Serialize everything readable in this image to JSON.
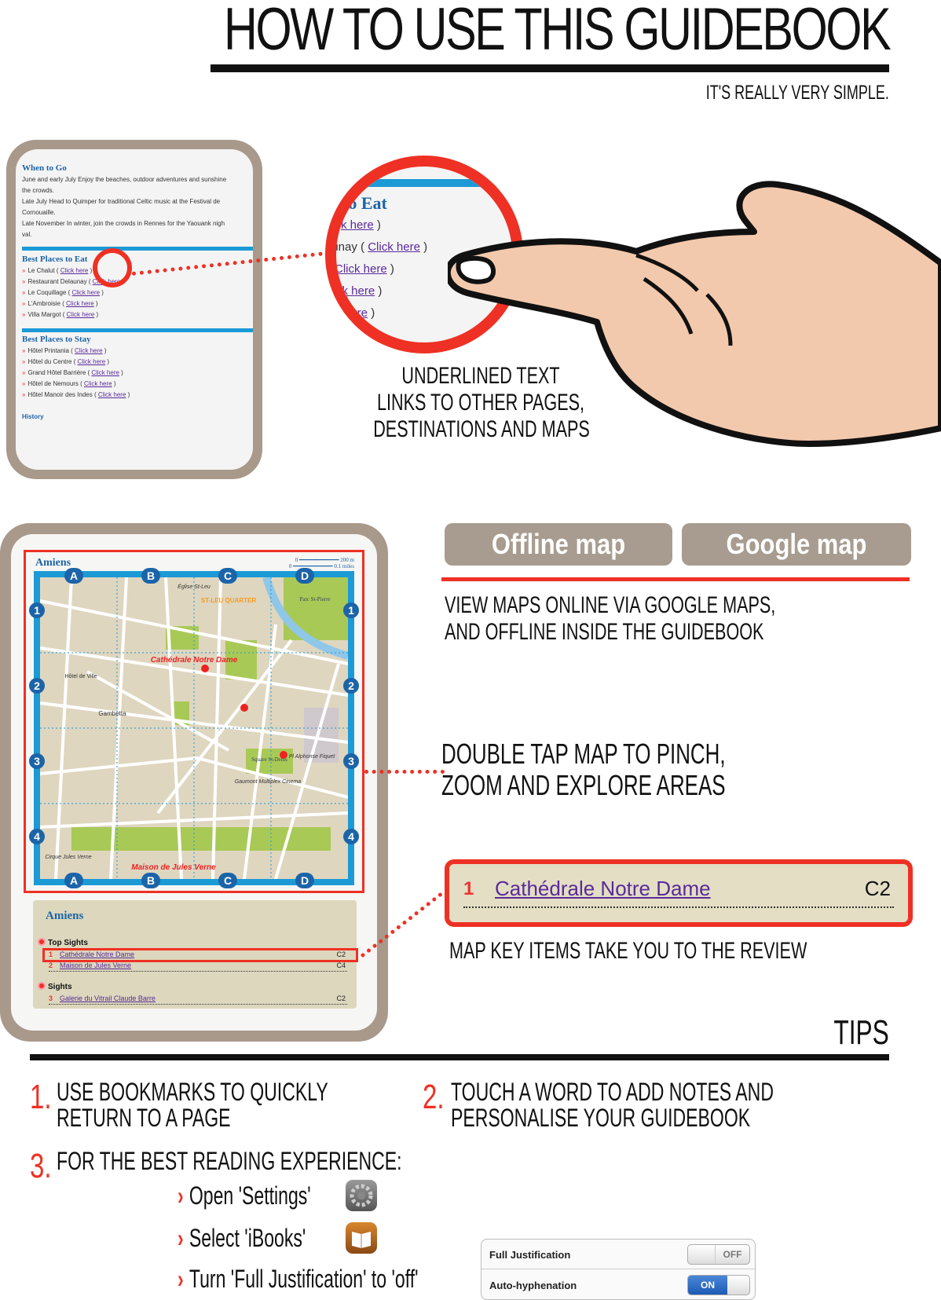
{
  "header": {
    "title": "HOW TO USE THIS GUIDEBOOK",
    "subtitle": "IT'S REALLY VERY SIMPLE."
  },
  "section_links": {
    "page": {
      "when_heading": "When to Go",
      "when_lines": [
        "June and early July Enjoy the beaches, outdoor adventures and sunshine",
        "the crowds.",
        "Late July Head to Quimper for traditional Celtic music at the Festival de",
        "Cornouaille.",
        "Late November In winter, join the crowds in Rennes for the Yaouank nigh",
        "val."
      ],
      "eat_heading": "Best Places to Eat",
      "eat_items": [
        {
          "name": "Le Chalut",
          "link": "Click here"
        },
        {
          "name": "Restaurant Delaunay",
          "link": "Click here"
        },
        {
          "name": "Le Coquillage",
          "link": "Click here"
        },
        {
          "name": "L'Ambroisie",
          "link": "Click here"
        },
        {
          "name": "Villa Margot",
          "link": "Click here"
        }
      ],
      "stay_heading": "Best Places to Stay",
      "stay_items": [
        {
          "name": "Hôtel Printania",
          "link": "Click here"
        },
        {
          "name": "Hôtel du Centre",
          "link": "Click here"
        },
        {
          "name": "Grand Hôtel Barrière",
          "link": "Click here"
        },
        {
          "name": "Hôtel de Nemours",
          "link": "Click here"
        },
        {
          "name": "Hôtel Manoir des Indes",
          "link": "Click here"
        }
      ],
      "history_heading": "History"
    },
    "zoom": {
      "heading": "to Eat",
      "lines": [
        "k here",
        "aunay",
        "Click here",
        "ck here",
        "here"
      ],
      "link": "Click here"
    },
    "caption": [
      "UNDERLINED TEXT",
      "LINKS TO OTHER PAGES,",
      "DESTINATIONS AND MAPS"
    ]
  },
  "section_maps": {
    "buttons": {
      "offline": "Offline map",
      "google": "Google map"
    },
    "caption_view": [
      "VIEW MAPS ONLINE VIA GOOGLE MAPS,",
      "AND OFFLINE INSIDE THE GUIDEBOOK"
    ],
    "caption_zoom": [
      "DOUBLE TAP MAP TO PINCH,",
      "ZOOM AND EXPLORE AREAS"
    ],
    "caption_key": "MAP KEY ITEMS TAKE YOU TO THE REVIEW",
    "map": {
      "title": "Amiens",
      "scale_metric": "200 m",
      "scale_imperial": "0.1 miles",
      "scale_zero": "0",
      "columns": [
        "A",
        "B",
        "C",
        "D"
      ],
      "rows": [
        "1",
        "2",
        "3",
        "4"
      ],
      "labels": [
        {
          "text": "Cathédrale Notre Dame",
          "kind": "highlight"
        },
        {
          "text": "ST-LEU QUARTER",
          "kind": "district"
        },
        {
          "text": "Maison de Jules Verne",
          "kind": "highlight"
        },
        {
          "text": "Parc St-Pierre",
          "kind": "park"
        },
        {
          "text": "Square St-Denis",
          "kind": "park"
        },
        {
          "text": "Gambetta",
          "kind": "street"
        },
        {
          "text": "Hôtel de Ville",
          "kind": "street"
        },
        {
          "text": "Gaumont Multiplex Cinema",
          "kind": "street"
        },
        {
          "text": "Pl Alphonse Fiquet",
          "kind": "street"
        },
        {
          "text": "Église St-Leu",
          "kind": "street"
        },
        {
          "text": "Cirque Jules Verne",
          "kind": "street"
        }
      ]
    },
    "key": {
      "title": "Amiens",
      "sections": [
        {
          "heading": "Top Sights",
          "items": [
            {
              "num": "1",
              "name": "Cathédrale Notre Dame",
              "grid": "C2"
            },
            {
              "num": "2",
              "name": "Maison de Jules Verne",
              "grid": "C4"
            }
          ]
        },
        {
          "heading": "Sights",
          "items": [
            {
              "num": "3",
              "name": "Galerie du Vitrail Claude Barre",
              "grid": "C2"
            }
          ]
        }
      ]
    },
    "key_enlarged": {
      "num": "1",
      "name": "Cathédrale Notre Dame",
      "grid": "C2"
    }
  },
  "tips": {
    "title": "TIPS",
    "items": [
      {
        "num": "1.",
        "lines": [
          "USE BOOKMARKS TO QUICKLY",
          "RETURN TO A PAGE"
        ]
      },
      {
        "num": "2.",
        "lines": [
          "TOUCH A WORD TO ADD NOTES AND",
          "PERSONALISE YOUR GUIDEBOOK"
        ]
      },
      {
        "num": "3.",
        "lines": [
          "FOR THE BEST READING EXPERIENCE:"
        ]
      }
    ],
    "steps": [
      "Open 'Settings'",
      "Select 'iBooks'",
      "Turn 'Full Justification' to 'off'"
    ],
    "settings": [
      {
        "label": "Full Justification",
        "state": "OFF"
      },
      {
        "label": "Auto-hyphenation",
        "state": "ON"
      }
    ]
  },
  "colors": {
    "accent_red": "#ee3124",
    "device_frame": "#a8998b",
    "link_purple": "#5a2a9a",
    "heading_blue": "#1c64a8"
  }
}
